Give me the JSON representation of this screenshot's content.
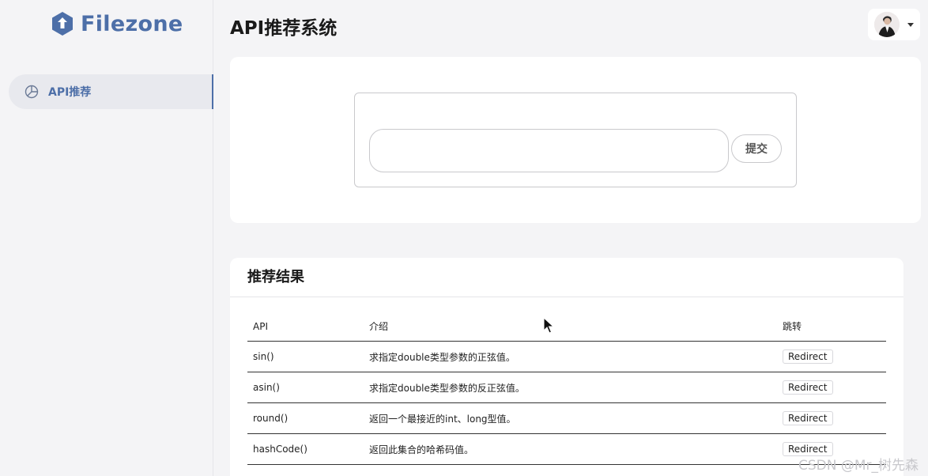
{
  "brand": {
    "name": "Filezone",
    "color": "#4d6fa8"
  },
  "sidebar": {
    "items": [
      {
        "label": "API推荐",
        "icon": "pie-chart-icon",
        "active": true
      }
    ]
  },
  "header": {
    "title": "API推荐系统",
    "user_menu": {
      "avatar": "user-avatar",
      "caret_icon": "caret-down-icon"
    }
  },
  "search": {
    "value": "",
    "placeholder": "",
    "submit_label": "提交"
  },
  "results": {
    "title": "推荐结果",
    "columns": [
      "API",
      "介绍",
      "跳转"
    ],
    "rows": [
      {
        "api": "sin()",
        "desc": "求指定double类型参数的正弦值。",
        "action": "Redirect"
      },
      {
        "api": "asin()",
        "desc": "求指定double类型参数的反正弦值。",
        "action": "Redirect"
      },
      {
        "api": "round()",
        "desc": "返回一个最接近的int、long型值。",
        "action": "Redirect"
      },
      {
        "api": "hashCode()",
        "desc": "返回此集合的哈希码值。",
        "action": "Redirect"
      }
    ]
  },
  "watermark": "CSDN @Mr_树先森"
}
